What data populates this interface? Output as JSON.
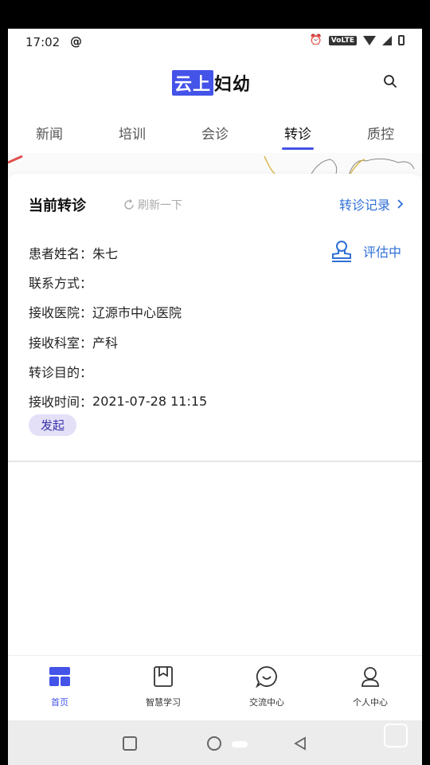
{
  "status_bar": {
    "time": "17:02",
    "at_icon": "@",
    "network_label": "VoLTE"
  },
  "header": {
    "logo_boxed": "云上",
    "logo_plain": "妇幼"
  },
  "tabs": [
    {
      "label": "新闻"
    },
    {
      "label": "培训"
    },
    {
      "label": "会诊"
    },
    {
      "label": "转诊"
    },
    {
      "label": "质控"
    }
  ],
  "card": {
    "title": "当前转诊",
    "refresh_label": "刷新一下",
    "record_link": "转诊记录",
    "status": "评估中",
    "rows": [
      {
        "label": "患者姓名：",
        "value": "朱七"
      },
      {
        "label": "联系方式：",
        "value": ""
      },
      {
        "label": "接收医院：",
        "value": "辽源市中心医院"
      },
      {
        "label": "接收科室：",
        "value": "产科"
      },
      {
        "label": "转诊目的：",
        "value": ""
      },
      {
        "label": "接收时间：",
        "value": "2021-07-28 11:15"
      }
    ],
    "badge": "发起"
  },
  "bottom_nav": [
    {
      "label": "首页",
      "icon": "home-grid-icon"
    },
    {
      "label": "智慧学习",
      "icon": "book-icon"
    },
    {
      "label": "交流中心",
      "icon": "chat-bubble-icon"
    },
    {
      "label": "个人中心",
      "icon": "person-icon"
    }
  ],
  "colors": {
    "accent": "#4453e8",
    "link": "#2f6fd6",
    "badge_bg": "#e3e0f8"
  }
}
